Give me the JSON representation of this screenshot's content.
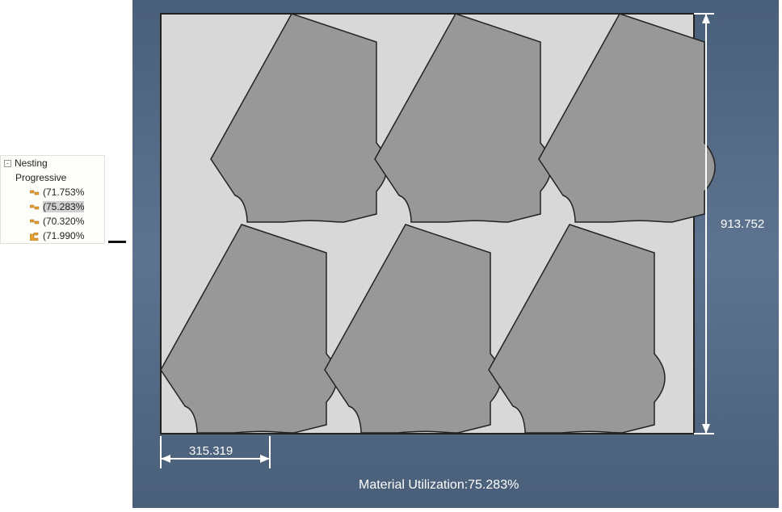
{
  "tree": {
    "root": "Nesting",
    "group": "Progressive",
    "items": [
      {
        "label": "(71.753%"
      },
      {
        "label": "(75.283%"
      },
      {
        "label": "(70.320%"
      },
      {
        "label": "(71.990%"
      }
    ],
    "selectedIndex": 1
  },
  "dimensions": {
    "width": "315.319",
    "height": "913.752"
  },
  "utilization": {
    "label": "Material Utilization:",
    "value": "75.283%"
  }
}
